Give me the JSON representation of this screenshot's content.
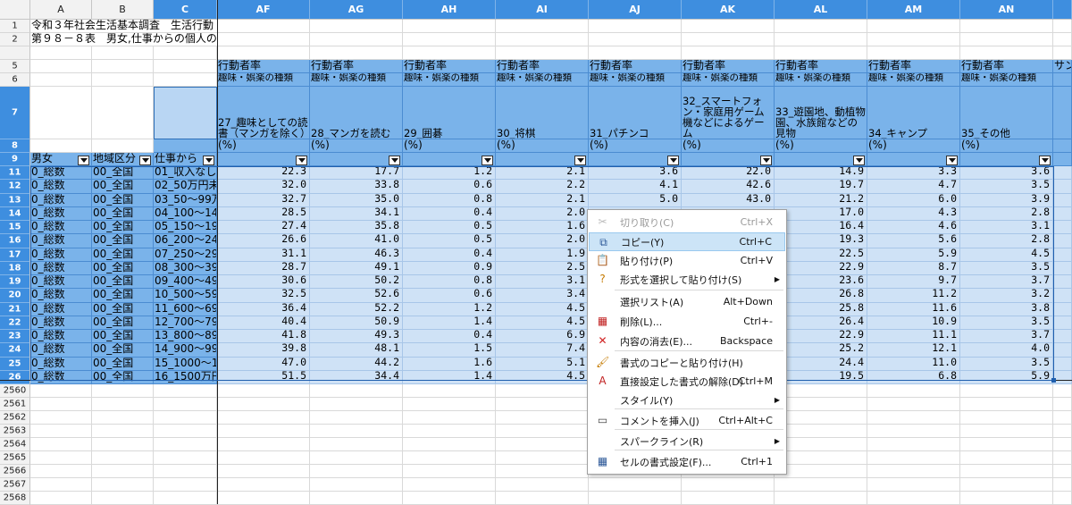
{
  "columns": [
    "A",
    "B",
    "C",
    "AF",
    "AG",
    "AH",
    "AI",
    "AJ",
    "AK",
    "AL",
    "AM",
    "AN"
  ],
  "top_rows": [
    "1",
    "2",
    "",
    "5",
    "6",
    "7",
    "8",
    "9"
  ],
  "row_numbers": [
    "11",
    "12",
    "13",
    "14",
    "15",
    "16",
    "17",
    "18",
    "19",
    "20",
    "21",
    "22",
    "23",
    "24",
    "25",
    "26"
  ],
  "empty_row_numbers": [
    "2560",
    "2561",
    "2562",
    "2563",
    "2564",
    "2565",
    "2566",
    "2567",
    "2568"
  ],
  "title_row1": "令和３年社会生活基本調査　生活行動",
  "title_row2": "第９８－８表　男女,仕事からの個人の",
  "row5_label": "行動者率",
  "row5_trailing": "サン",
  "row6_label": "趣味・娯楽の種類",
  "activities": [
    "27_趣味としての読書（マンガを除く）",
    "28_マンガを読む",
    "29_囲碁",
    "30_将棋",
    "31_パチンコ",
    "32_スマートフォン・家庭用ゲーム機などによるゲーム",
    "33_遊園地、動植物園、水族館などの見物",
    "34_キャンプ",
    "35_その他"
  ],
  "unit": "(%)",
  "filter_headers": [
    "男女",
    "地域区分",
    "仕事から"
  ],
  "sex": "0_総数",
  "region": "00_全国",
  "income": [
    "01_収入なし",
    "02_50万円未",
    "03_50～99万",
    "04_100～149",
    "05_150～199",
    "06_200～249",
    "07_250～299",
    "08_300～399",
    "09_400～499",
    "10_500～599",
    "11_600～699",
    "12_700～799",
    "13_800～899",
    "14_900～999",
    "15_1000～1",
    "16_1500万円"
  ],
  "values": [
    [
      "22.3",
      "17.7",
      "1.2",
      "2.1",
      "3.6",
      "22.0",
      "14.9",
      "3.3",
      "3.6"
    ],
    [
      "32.0",
      "33.8",
      "0.6",
      "2.2",
      "4.1",
      "42.6",
      "19.7",
      "4.7",
      "3.5"
    ],
    [
      "32.7",
      "35.0",
      "0.8",
      "2.1",
      "5.0",
      "43.0",
      "21.2",
      "6.0",
      "3.9"
    ],
    [
      "28.5",
      "34.1",
      "0.4",
      "2.0",
      "",
      "",
      "17.0",
      "4.3",
      "2.8"
    ],
    [
      "27.4",
      "35.8",
      "0.5",
      "1.6",
      "",
      "",
      "16.4",
      "4.6",
      "3.1"
    ],
    [
      "26.6",
      "41.0",
      "0.5",
      "2.0",
      "",
      "",
      "19.3",
      "5.6",
      "2.8"
    ],
    [
      "31.1",
      "46.3",
      "0.4",
      "1.9",
      "",
      "",
      "22.5",
      "5.9",
      "4.5"
    ],
    [
      "28.7",
      "49.1",
      "0.9",
      "2.5",
      "",
      "",
      "22.9",
      "8.7",
      "3.5"
    ],
    [
      "30.6",
      "50.2",
      "0.8",
      "3.1",
      "",
      "",
      "23.6",
      "9.7",
      "3.7"
    ],
    [
      "32.5",
      "52.6",
      "0.6",
      "3.4",
      "",
      "",
      "26.8",
      "11.2",
      "3.2"
    ],
    [
      "36.4",
      "52.2",
      "1.2",
      "4.5",
      "",
      "",
      "25.8",
      "11.6",
      "3.8"
    ],
    [
      "40.4",
      "50.9",
      "1.4",
      "4.5",
      "",
      "",
      "26.4",
      "10.9",
      "3.5"
    ],
    [
      "41.8",
      "49.3",
      "0.4",
      "6.9",
      "",
      "",
      "22.9",
      "11.1",
      "3.7"
    ],
    [
      "39.8",
      "48.1",
      "1.5",
      "7.4",
      "",
      "",
      "25.2",
      "12.1",
      "4.0"
    ],
    [
      "47.0",
      "44.2",
      "1.6",
      "5.1",
      "",
      "",
      "24.4",
      "11.0",
      "3.5"
    ],
    [
      "51.5",
      "34.4",
      "1.4",
      "4.5",
      "",
      "",
      "19.5",
      "6.8",
      "5.9"
    ]
  ],
  "context_menu": [
    {
      "label": "切り取り(C)",
      "shortcut": "Ctrl+X",
      "icon": "scissors-icon",
      "disabled": true
    },
    {
      "label": "コピー(Y)",
      "shortcut": "Ctrl+C",
      "icon": "copy-icon",
      "highlighted": true
    },
    {
      "label": "貼り付け(P)",
      "shortcut": "Ctrl+V",
      "icon": "paste-icon"
    },
    {
      "label": "形式を選択して貼り付け(S)",
      "shortcut": "",
      "icon": "paste-special-icon",
      "submenu": true
    },
    {
      "label": "選択リスト(A)",
      "shortcut": "Alt+Down",
      "icon": ""
    },
    {
      "label": "削除(L)...",
      "shortcut": "Ctrl+-",
      "icon": "delete-cells-icon"
    },
    {
      "label": "内容の消去(E)...",
      "shortcut": "Backspace",
      "icon": "clear-contents-icon"
    },
    {
      "label": "書式のコピーと貼り付け(H)",
      "shortcut": "",
      "icon": "clone-formatting-icon"
    },
    {
      "label": "直接設定した書式の解除(D)",
      "shortcut": "Ctrl+M",
      "icon": "clear-formatting-icon"
    },
    {
      "label": "スタイル(Y)",
      "shortcut": "",
      "icon": "",
      "submenu": true
    },
    {
      "label": "コメントを挿入(J)",
      "shortcut": "Ctrl+Alt+C",
      "icon": "comment-icon"
    },
    {
      "label": "スパークライン(R)",
      "shortcut": "",
      "icon": "",
      "submenu": true
    },
    {
      "label": "セルの書式設定(F)...",
      "shortcut": "Ctrl+1",
      "icon": "format-cells-icon"
    }
  ]
}
